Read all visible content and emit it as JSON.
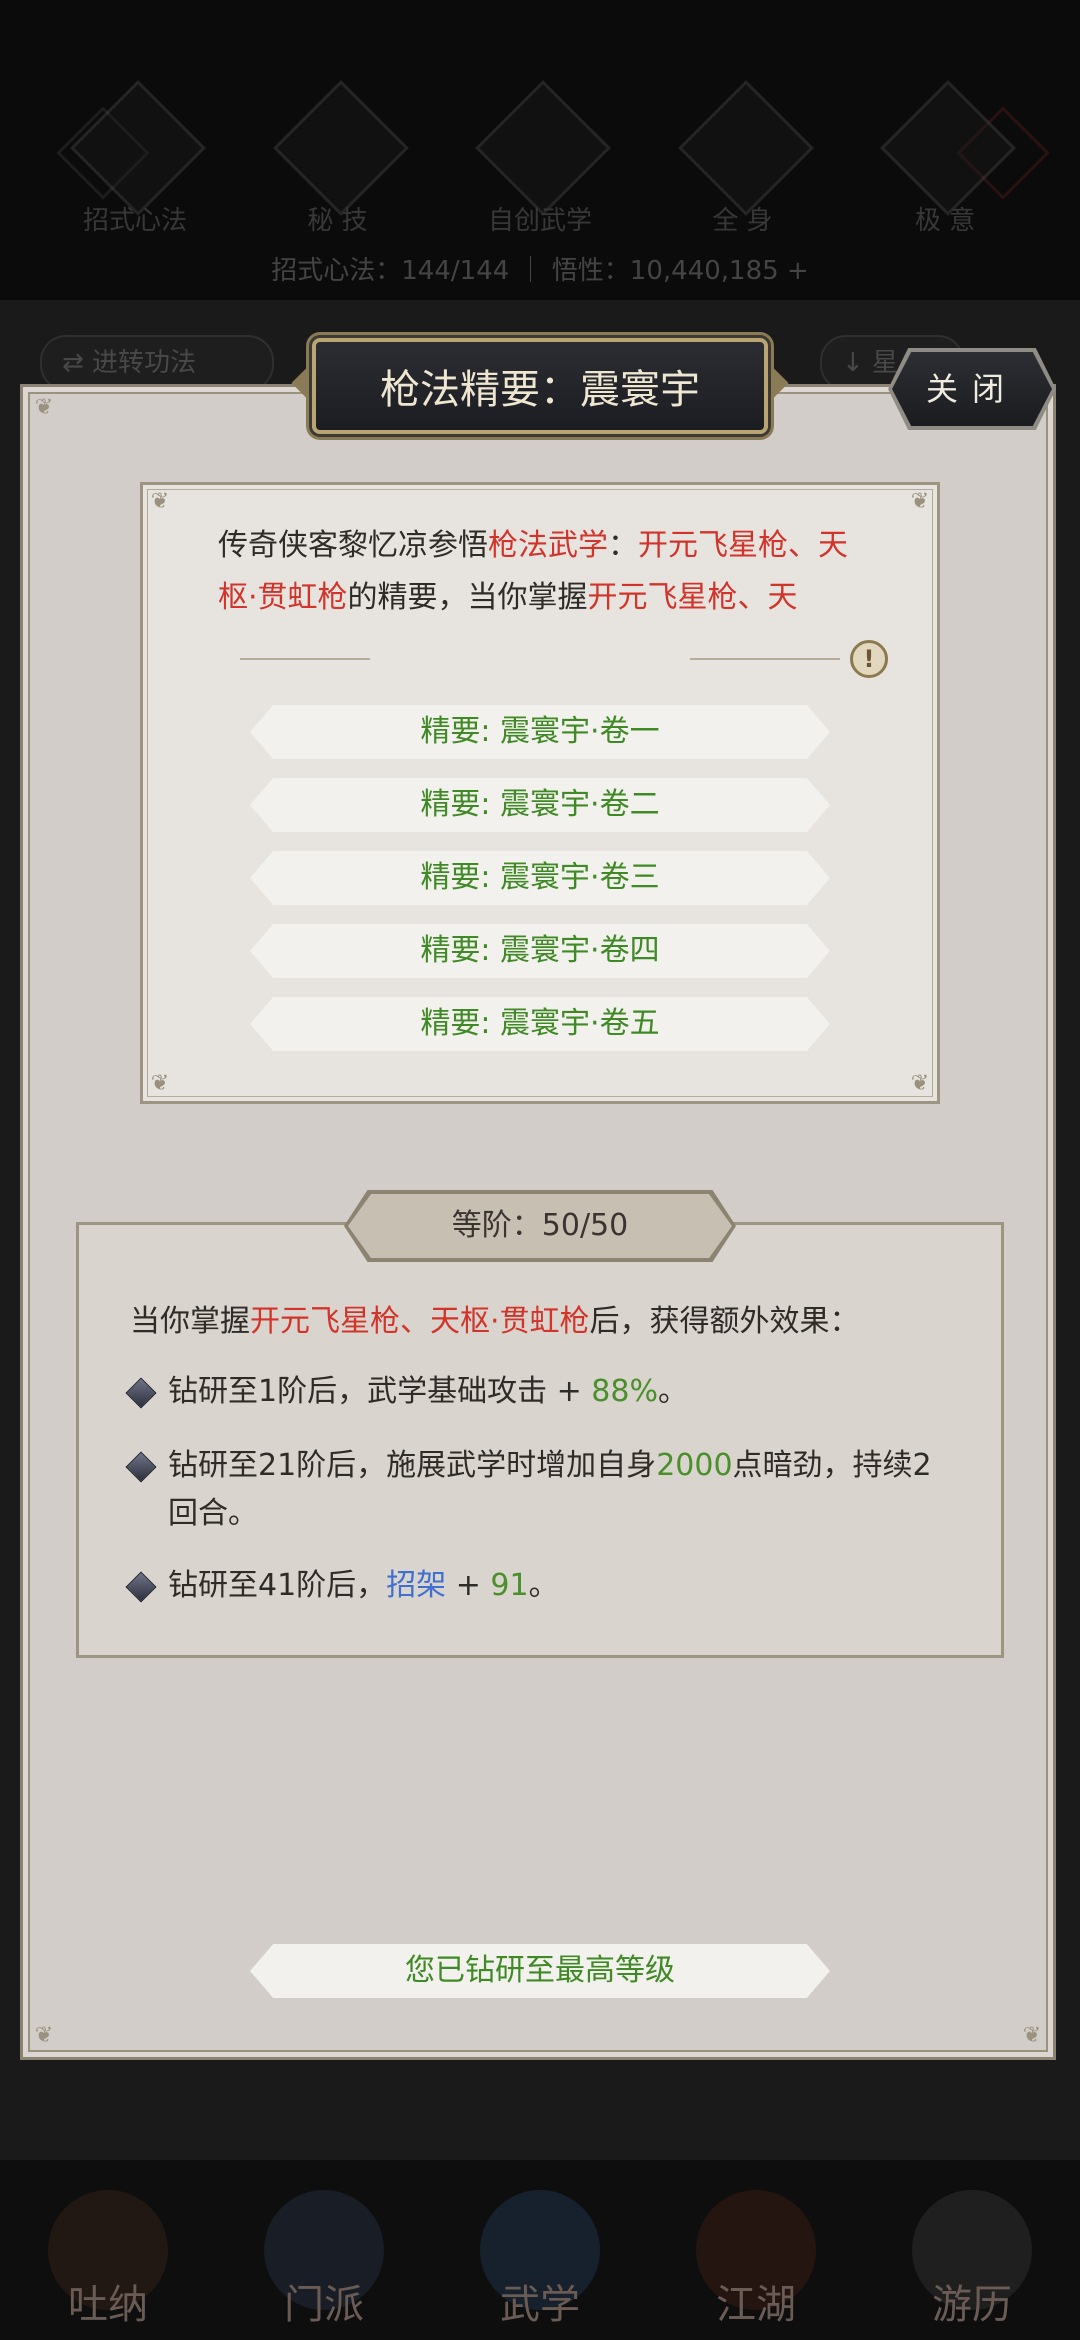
{
  "background": {
    "tabs": [
      "招式心法",
      "秘 技",
      "自创武学",
      "全 身",
      "极 意"
    ],
    "stat_line": "招式心法：144/144 ｜ 悟性：10,440,185 +",
    "left_button": "⇄ 进转功法",
    "right_button": "↓ 星",
    "under_text": "",
    "under_text2": "",
    "under_text_right": "",
    "bottom_nav": [
      "吐纳",
      "门派",
      "武学",
      "江湖",
      "游历"
    ]
  },
  "dialog": {
    "title": "枪法精要：震寰宇",
    "close_label": "关闭",
    "description": {
      "part1": "传奇侠客黎忆凉参悟",
      "part2": "枪法武学",
      "part3": "：",
      "part4": "开元飞星枪、天枢·贯虹枪",
      "part5": "的精要，当你掌握",
      "part6": "开元飞星枪、天"
    },
    "warning_icon_text": "!",
    "volumes": [
      "精要: 震寰宇·卷一",
      "精要: 震寰宇·卷二",
      "精要: 震寰宇·卷三",
      "精要: 震寰宇·卷四",
      "精要: 震寰宇·卷五"
    ],
    "grade_label": "等阶：50/50",
    "effect_intro": {
      "prefix": "当你掌握",
      "skills": "开元飞星枪、天枢·贯虹枪",
      "suffix": "后，获得额外效果："
    },
    "effects": [
      {
        "text1": "钻研至1阶后，武学基础攻击 + ",
        "highlight": "88%",
        "text2": "。",
        "hl_color": "green"
      },
      {
        "text1": "钻研至21阶后，施展武学时增加自身",
        "highlight": "2000",
        "text2": "点暗劲，持续2回合。",
        "hl_color": "green"
      },
      {
        "text1": "钻研至41阶后，",
        "keyword": "招架",
        "text_mid": " + ",
        "highlight": "91",
        "text2": "。",
        "hl_color": "green"
      }
    ],
    "max_level_label": "您已钻研至最高等级"
  },
  "colors": {
    "panel_bg": "#d2cdc8",
    "highlight_red": "#d2342a",
    "highlight_green": "#4b8f2c",
    "highlight_blue": "#3f6fd0"
  }
}
